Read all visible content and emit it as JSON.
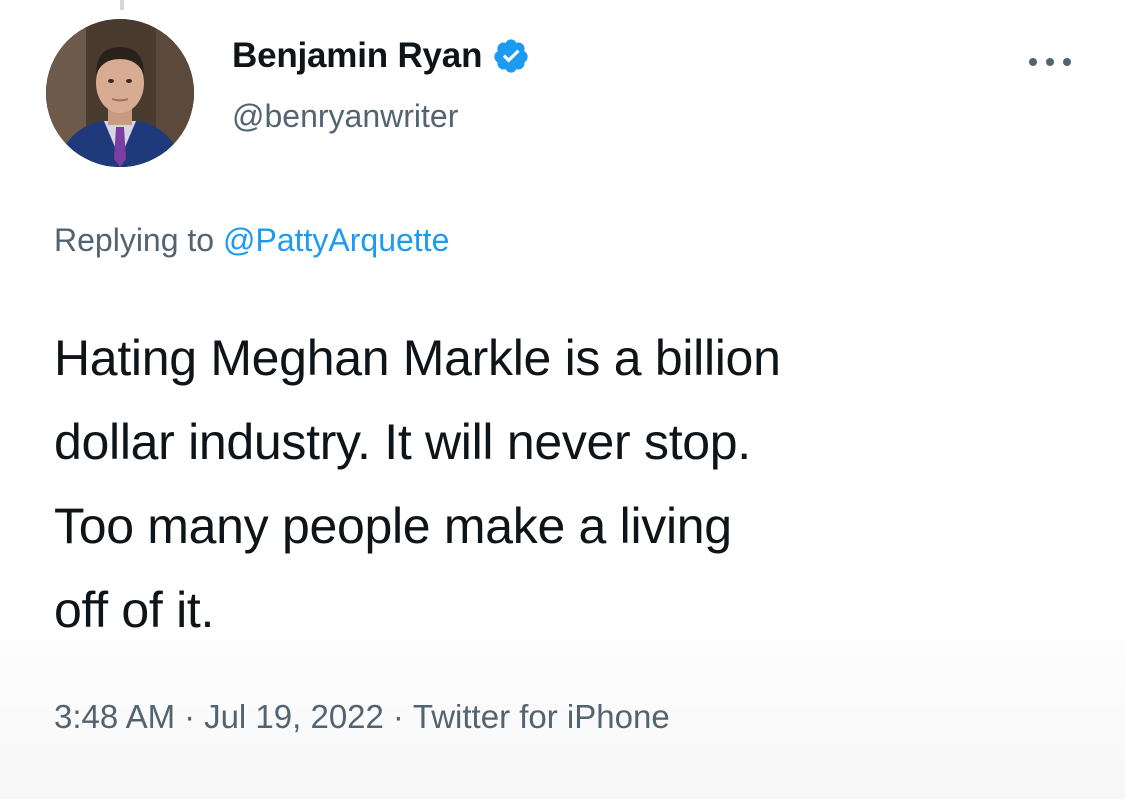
{
  "author": {
    "display_name": "Benjamin Ryan",
    "handle": "@benryanwriter",
    "verified": true,
    "avatar_icon": "profile-photo-avatar"
  },
  "more_icon": "more-options-icon",
  "reply": {
    "prefix": "Replying to",
    "target": "@PattyArquette"
  },
  "tweet": {
    "lines": [
      "Hating Meghan Markle is a billion",
      "dollar industry. It will never stop.",
      "Too many people make a living",
      "off of it."
    ]
  },
  "meta": {
    "time": "3:48 AM",
    "separator": "·",
    "date": "Jul 19, 2022",
    "source": "Twitter for iPhone"
  },
  "colors": {
    "accent": "#1d9bf0",
    "secondary_text": "#536471",
    "primary_text": "#0f1419"
  }
}
